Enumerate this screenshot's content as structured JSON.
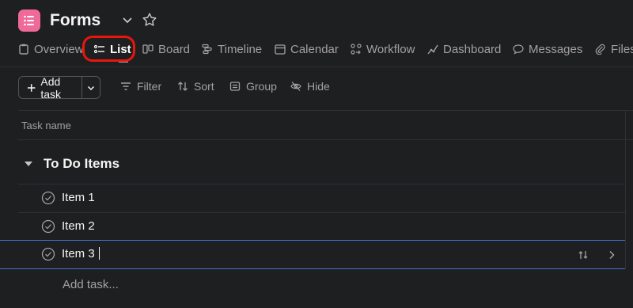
{
  "project": {
    "title": "Forms",
    "icon": "list-icon",
    "brand_color": "#f06a99"
  },
  "tabs": [
    {
      "label": "Overview",
      "icon": "clipboard-icon"
    },
    {
      "label": "List",
      "icon": "list-icon",
      "active": true
    },
    {
      "label": "Board",
      "icon": "board-icon"
    },
    {
      "label": "Timeline",
      "icon": "timeline-icon"
    },
    {
      "label": "Calendar",
      "icon": "calendar-icon"
    },
    {
      "label": "Workflow",
      "icon": "workflow-icon"
    },
    {
      "label": "Dashboard",
      "icon": "dashboard-icon"
    },
    {
      "label": "Messages",
      "icon": "message-icon"
    },
    {
      "label": "Files",
      "icon": "paperclip-icon"
    }
  ],
  "toolbar": {
    "add_task": "Add task",
    "filter": "Filter",
    "sort": "Sort",
    "group": "Group",
    "hide": "Hide"
  },
  "table": {
    "column_task_name": "Task name"
  },
  "section": {
    "title": "To Do Items",
    "tasks": [
      {
        "name": "Item 1"
      },
      {
        "name": "Item 2"
      },
      {
        "name": "Item 3",
        "editing": true
      }
    ],
    "add_task_placeholder": "Add task..."
  },
  "colors": {
    "highlight": "#e8160c",
    "selection": "#4573d2",
    "background": "#1e1f21"
  }
}
